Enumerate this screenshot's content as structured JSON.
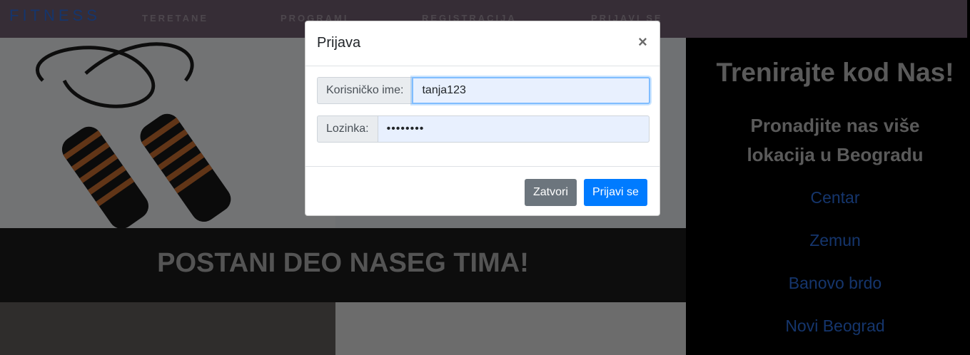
{
  "navbar": {
    "brand": "FITNESS",
    "links": [
      "TERETANE",
      "PROGRAMI",
      "REGISTRACIJA",
      "PRIJAVI SE"
    ]
  },
  "banner": {
    "title": "POSTANI DEO NASEG TIMA!"
  },
  "side": {
    "title": "Trenirajte kod Nas!",
    "subtitle": "Pronadjite nas više lokacija u Beogradu",
    "locations": [
      "Centar",
      "Zemun",
      "Banovo brdo",
      "Novi Beograd"
    ]
  },
  "modal": {
    "title": "Prijava",
    "close_symbol": "×",
    "username_label": "Korisničko ime:",
    "username_value": "tanja123",
    "password_label": "Lozinka:",
    "password_value": "••••••••",
    "close_button": "Zatvori",
    "submit_button": "Prijavi se"
  },
  "colors": {
    "accent": "#007bff",
    "link": "#2a6bd8",
    "secondary": "#6c757d"
  }
}
